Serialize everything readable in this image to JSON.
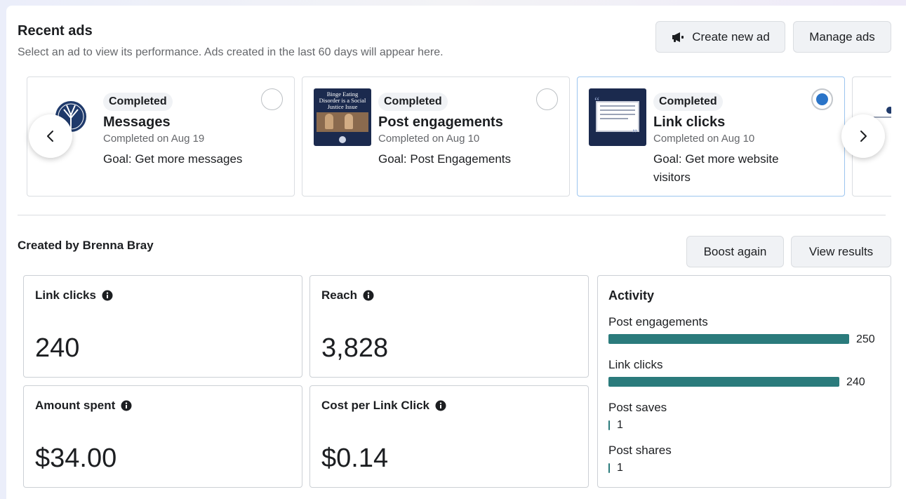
{
  "header": {
    "title": "Recent ads",
    "subtitle": "Select an ad to view its performance. Ads created in the last 60 days will appear here.",
    "create_label": "Create new ad",
    "manage_label": "Manage ads"
  },
  "carousel": {
    "cards": [
      {
        "status": "Completed",
        "title": "Messages",
        "date": "Completed on Aug 19",
        "goal": "Goal: Get more messages",
        "selected": false
      },
      {
        "status": "Completed",
        "title": "Post engagements",
        "date": "Completed on Aug 10",
        "goal": "Goal: Post Engagements",
        "selected": false,
        "thumb_text": "Binge Eating Disorder is a Social Justice Issue"
      },
      {
        "status": "Completed",
        "title": "Link clicks",
        "date": "Completed on Aug 10",
        "goal": "Goal: Get more website visitors",
        "selected": true
      }
    ]
  },
  "results": {
    "creator": "Created by Brenna Bray",
    "boost_label": "Boost again",
    "view_label": "View results",
    "metrics": [
      {
        "label": "Link clicks",
        "value": "240"
      },
      {
        "label": "Reach",
        "value": "3,828"
      },
      {
        "label": "Amount spent",
        "value": "$34.00"
      },
      {
        "label": "Cost per Link Click",
        "value": "$0.14"
      }
    ]
  },
  "activity": {
    "title": "Activity",
    "max": 250,
    "items": [
      {
        "label": "Post engagements",
        "value": 250,
        "value_text": "250"
      },
      {
        "label": "Link clicks",
        "value": 240,
        "value_text": "240"
      },
      {
        "label": "Post saves",
        "value": 1,
        "value_text": "1"
      },
      {
        "label": "Post shares",
        "value": 1,
        "value_text": "1"
      }
    ]
  },
  "colors": {
    "bar": "#2b7b7c",
    "radio_selected": "#2a74c8",
    "selected_border": "#9cc5ef"
  },
  "icons": [
    "megaphone-icon",
    "chevron-left-icon",
    "chevron-right-icon",
    "info-icon"
  ]
}
